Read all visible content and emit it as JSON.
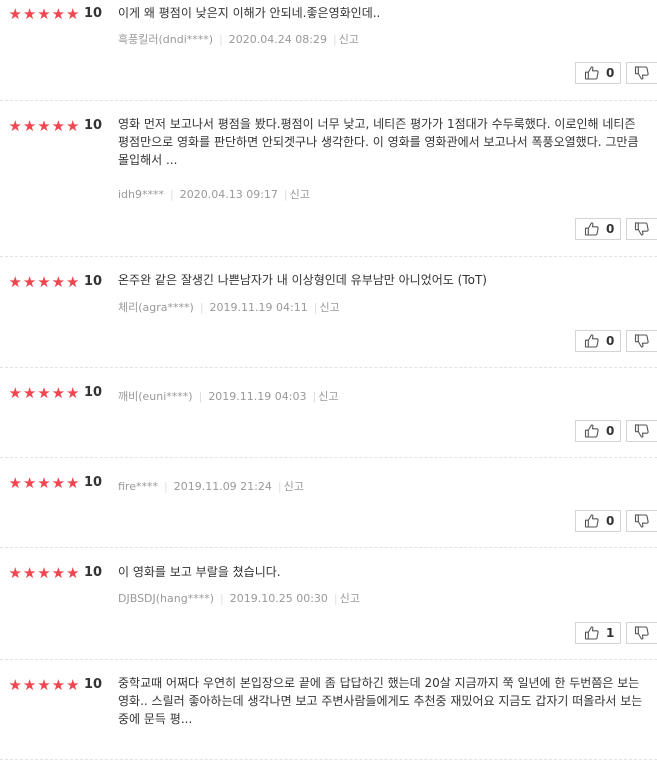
{
  "reviews": [
    {
      "stars": 5,
      "score": "10",
      "text": "이게 왜 평점이 낮은지 이해가 안되네.좋은영화인데..",
      "author": "흑풍킬러(dndi****)",
      "date": "2020.04.24 08:29",
      "report": "신고",
      "likes": "0"
    },
    {
      "stars": 5,
      "score": "10",
      "text": "영화 먼저 보고나서 평점을 봤다.평점이 너무 낮고, 네티즌 평가가 1점대가 수두룩했다. 이로인해 네티즌 평점만으로 영화를 판단하면 안되겟구나 생각한다. 이 영화를 영화관에서 보고나서 폭풍오열했다. 그만큼 몰입해서 ...",
      "author": "idh9****",
      "date": "2020.04.13 09:17",
      "report": "신고",
      "likes": "0"
    },
    {
      "stars": 5,
      "score": "10",
      "text": "온주완 같은 잘생긴 나쁜남자가 내 이상형인데 유부남만 아니었어도 (ToT)",
      "author": "체리(agra****)",
      "date": "2019.11.19 04:11",
      "report": "신고",
      "likes": "0"
    },
    {
      "stars": 5,
      "score": "10",
      "text": "",
      "author": "깨비(euni****)",
      "date": "2019.11.19 04:03",
      "report": "신고",
      "likes": "0"
    },
    {
      "stars": 5,
      "score": "10",
      "text": "",
      "author": "fire****",
      "date": "2019.11.09 21:24",
      "report": "신고",
      "likes": "0"
    },
    {
      "stars": 5,
      "score": "10",
      "text": "이 영화를 보고 부랄을 쳤습니다.",
      "author": "DJBSDJ(hang****)",
      "date": "2019.10.25 00:30",
      "report": "신고",
      "likes": "1"
    },
    {
      "stars": 5,
      "score": "10",
      "text": "중학교때 어쩌다 우연히 본입장으로 끝에 좀 답답하긴 했는데 20살 지금까지 쭉 일년에 한 두번쯤은 보는영화.. 스릴러 좋아하는데 생각나면 보고 주변사람들에게도 추천중 재밌어요 지금도 갑자기 떠올라서 보는중에 문득 평...",
      "author": "",
      "date": "",
      "report": "",
      "likes": ""
    }
  ],
  "icons": {
    "star": "star-icon",
    "like": "thumbs-up-icon",
    "dislike": "thumbs-down-icon"
  },
  "colors": {
    "star": "#f14650",
    "meta": "#999999",
    "text": "#333333",
    "button_border": "#d4d4d4"
  }
}
